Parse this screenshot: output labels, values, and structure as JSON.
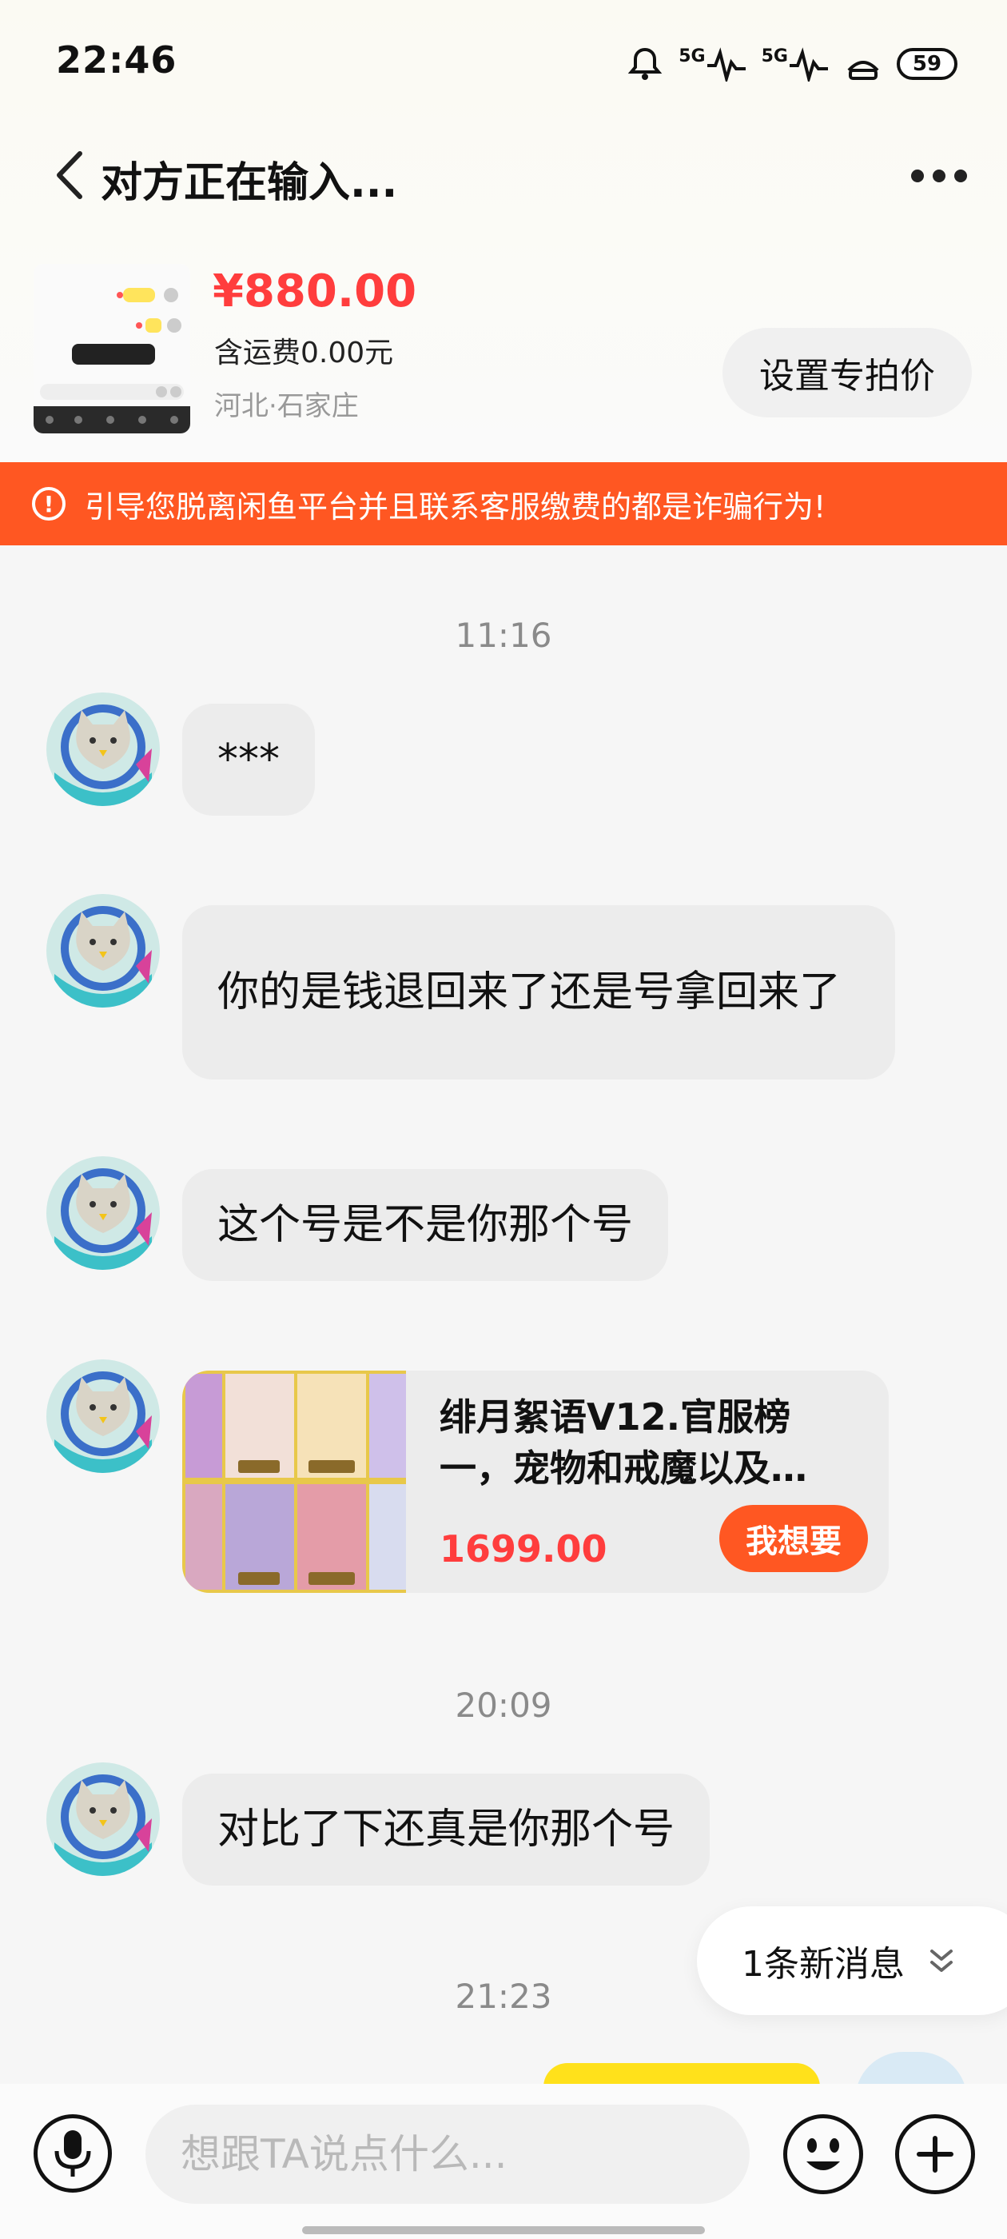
{
  "status_bar": {
    "time": "22:46",
    "signal1": "5G",
    "signal2": "5G",
    "battery": "59"
  },
  "header": {
    "title": "对方正在输入...",
    "back_icon": "chevron-left-icon",
    "more_icon": "more-dots-icon"
  },
  "product": {
    "price": "¥880.00",
    "shipping": "含运费0.00元",
    "location": "河北·石家庄",
    "set_price_button": "设置专拍价"
  },
  "warning": {
    "text": "引导您脱离闲鱼平台并且联系客服缴费的都是诈骗行为!",
    "icon": "!"
  },
  "messages": {
    "time1": "11:16",
    "m1": "***",
    "m2": "你的是钱退回来了还是号拿回来了",
    "m3": "这个号是不是你那个号",
    "card": {
      "title": "绯月絮语V12.官服榜一，宠物和戒魔以及…",
      "price": "1699.00",
      "button": "我想要"
    },
    "time2": "20:09",
    "m4": "对比了下还真是你那个号",
    "time3": "21:23"
  },
  "new_message": {
    "label": "1条新消息"
  },
  "input_bar": {
    "placeholder": "想跟TA说点什么..."
  },
  "colors": {
    "accent_orange": "#ff5722",
    "price_red": "#ff3d3d",
    "bubble_gray": "#ececec"
  }
}
